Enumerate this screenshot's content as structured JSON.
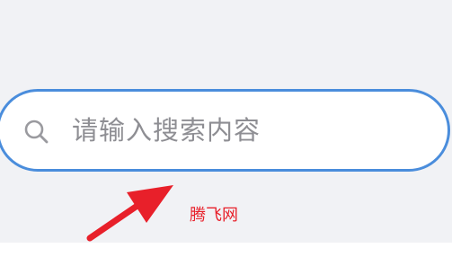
{
  "search": {
    "placeholder": "请输入搜索内容",
    "icon": "search-icon"
  },
  "annotation": {
    "watermark_text": "腾飞网",
    "arrow_color": "#e8202a"
  },
  "colors": {
    "background": "#f1f2f5",
    "search_border": "#4a8ddc",
    "placeholder_text": "#8e8e93"
  }
}
